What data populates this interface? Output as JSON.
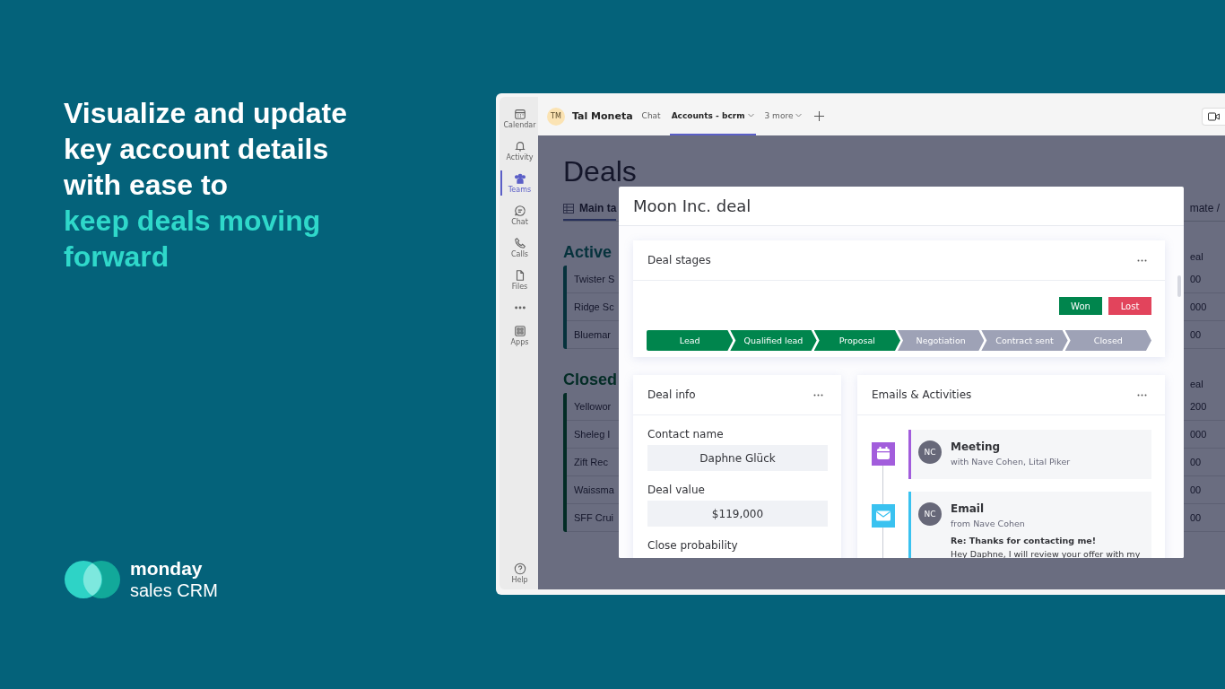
{
  "promo": {
    "headline": "Visualize and update key account details with ease to",
    "headline_accent": "keep deals moving forward",
    "logo": {
      "brand": "monday",
      "product": "sales CRM"
    }
  },
  "app_rail": [
    {
      "kind": "calendar",
      "label": "Calendar",
      "selected": false
    },
    {
      "kind": "bell",
      "label": "Activity",
      "selected": false
    },
    {
      "kind": "people",
      "label": "Teams",
      "selected": true
    },
    {
      "kind": "chat",
      "label": "Chat",
      "selected": false
    },
    {
      "kind": "phone",
      "label": "Calls",
      "selected": false
    },
    {
      "kind": "file",
      "label": "Files",
      "selected": false
    },
    {
      "kind": "more",
      "selected": false
    },
    {
      "kind": "apps",
      "label": "Apps",
      "selected": false
    }
  ],
  "help": {
    "label": "Help"
  },
  "header": {
    "avatar": "TM",
    "name": "Tal Moneta",
    "tabs": [
      {
        "label": "Chat",
        "selected": false,
        "dropdown": false
      },
      {
        "label": "Accounts - bcrm",
        "selected": true,
        "dropdown": true
      },
      {
        "label": "3 more",
        "selected": false,
        "dropdown": true
      }
    ]
  },
  "board": {
    "title": "Deals",
    "view_tab": "Main ta",
    "view_tab_right": "mate /",
    "groups": [
      {
        "name": "Active",
        "color": "#06323c",
        "column_header": "eal",
        "rows": [
          {
            "name": "Twister S",
            "value": "00"
          },
          {
            "name": "Ridge Sc",
            "value": "000"
          },
          {
            "name": "Bluemar",
            "value": "00"
          }
        ]
      },
      {
        "name": "Closed",
        "color": "#032c25",
        "column_header": "eal",
        "rows": [
          {
            "name": "Yellowor",
            "value": "200"
          },
          {
            "name": "Sheleg I",
            "value": "000"
          },
          {
            "name": "Zift Rec",
            "value": "00"
          },
          {
            "name": "Waissma",
            "value": "00"
          },
          {
            "name": "SFF Crui",
            "value": "00"
          }
        ]
      }
    ]
  },
  "modal": {
    "title": "Moon Inc. deal",
    "stages_card": {
      "title": "Deal stages",
      "outcomes": [
        {
          "kind": "won",
          "label": "Won"
        },
        {
          "kind": "lost",
          "label": "Lost"
        }
      ],
      "stages": [
        {
          "label": "Lead",
          "completed": true
        },
        {
          "label": "Qualified lead",
          "completed": true
        },
        {
          "label": "Proposal",
          "completed": true
        },
        {
          "label": "Negotiation",
          "completed": false
        },
        {
          "label": "Contract sent",
          "completed": false
        },
        {
          "label": "Closed",
          "completed": false
        }
      ]
    },
    "info_card": {
      "title": "Deal info",
      "fields": [
        {
          "label": "Contact name",
          "value": "Daphne Glück"
        },
        {
          "label": "Deal value",
          "value": "$119,000"
        }
      ],
      "trailing_label": "Close probability"
    },
    "activity_card": {
      "title": "Emails & Activities",
      "items": [
        {
          "kind": "meeting",
          "avatar": "NC",
          "title": "Meeting",
          "subtitle": "with Nave Cohen, Lital Piker"
        },
        {
          "kind": "email",
          "avatar": "NC",
          "title": "Email",
          "subtitle": "from Nave Cohen",
          "subject": "Re: Thanks for contacting me!",
          "preview": "Hey Daphne, I will review your offer with my"
        }
      ]
    }
  }
}
